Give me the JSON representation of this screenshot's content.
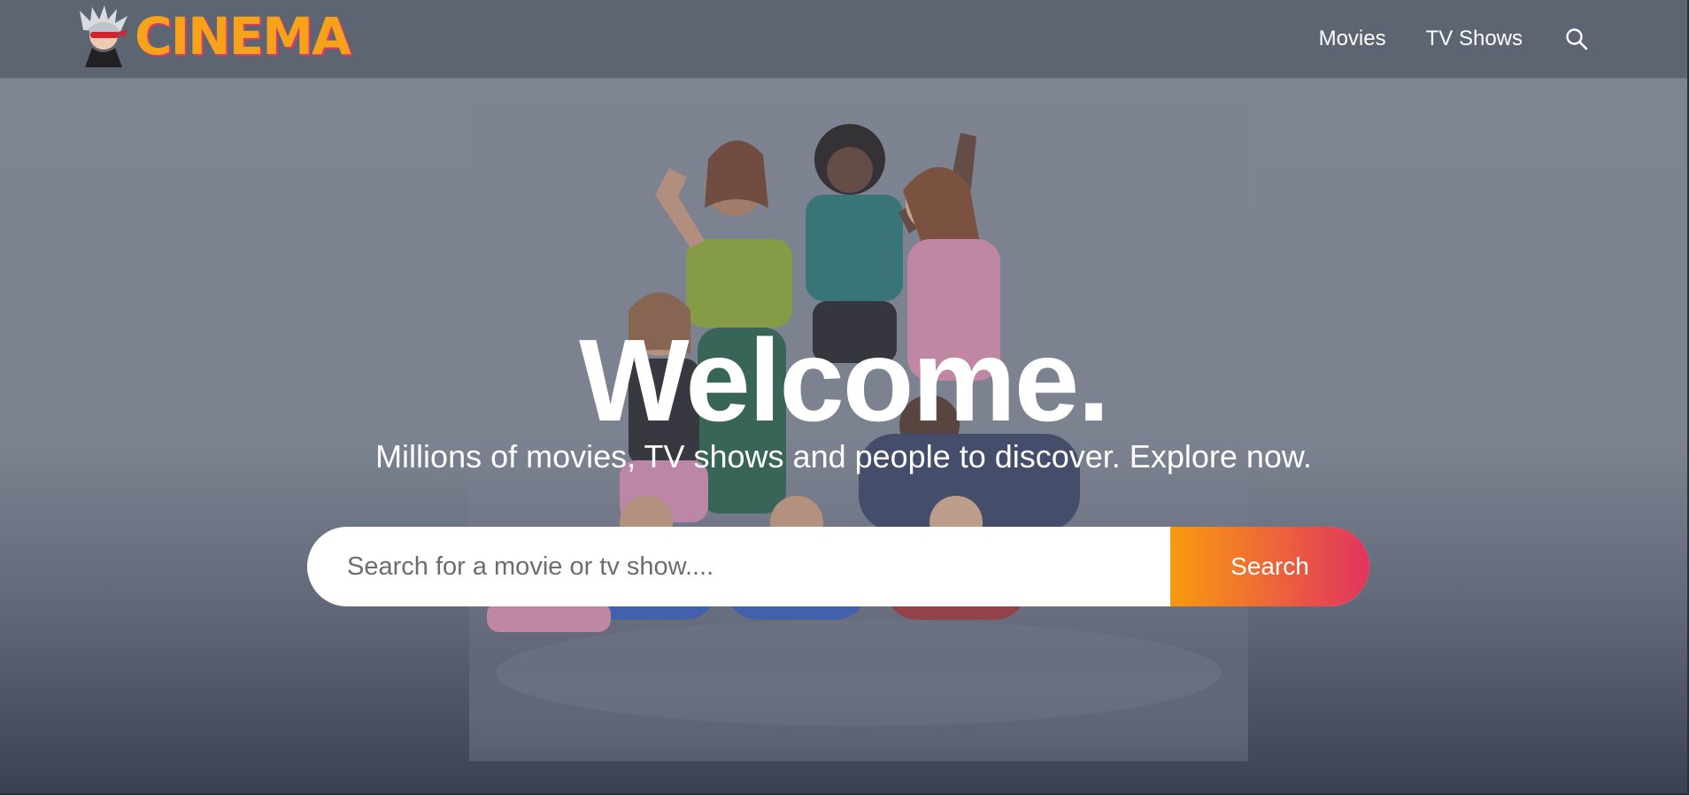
{
  "header": {
    "logo_text": "CINEMA",
    "logo_icon": "anime-mascot-icon",
    "nav": [
      {
        "label": "Movies"
      },
      {
        "label": "TV Shows"
      }
    ],
    "search_icon": "search-icon"
  },
  "hero": {
    "title": "Welcome.",
    "subtitle": "Millions of movies, TV shows and people to discover. Explore now.",
    "search": {
      "placeholder": "Search for a movie or tv show....",
      "value": "",
      "button_label": "Search"
    }
  },
  "colors": {
    "logo": "#f6a21a",
    "logo_shadow": "#e0366a",
    "header_bg": "#5d6472",
    "button_gradient_start": "#f89a0e",
    "button_gradient_end": "#e2345f"
  }
}
